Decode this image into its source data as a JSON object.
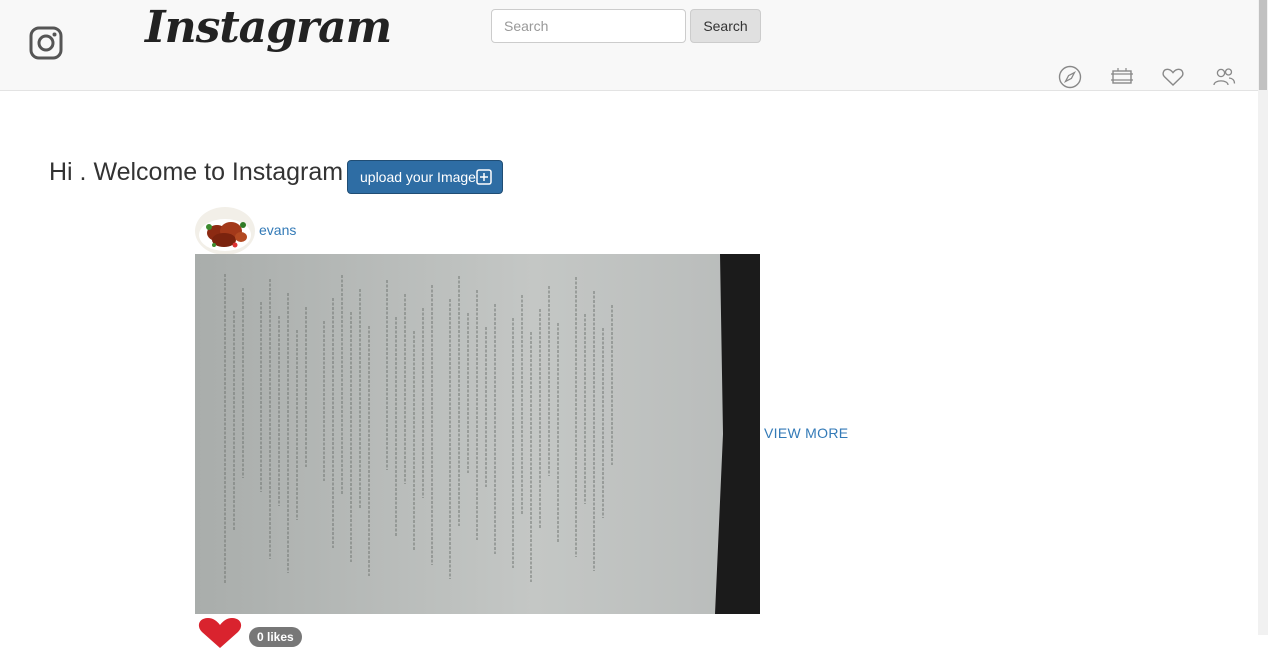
{
  "header": {
    "logo_text": "Instagram",
    "search": {
      "placeholder": "Search",
      "value": "",
      "button_label": "Search"
    },
    "nav_icons": [
      "explore-icon",
      "feed-icon",
      "heart-icon",
      "people-icon"
    ]
  },
  "main": {
    "welcome_text": "Hi . Welcome to Instagram",
    "upload_label": "upload your Image"
  },
  "post": {
    "username": "evans",
    "view_more_label": "VIEW MORE",
    "likes_label": "0 likes"
  },
  "colors": {
    "primary_button": "#2e6da4",
    "link": "#337ab7",
    "like_heart": "#d9232e",
    "navbar_bg": "#f8f8f8"
  }
}
